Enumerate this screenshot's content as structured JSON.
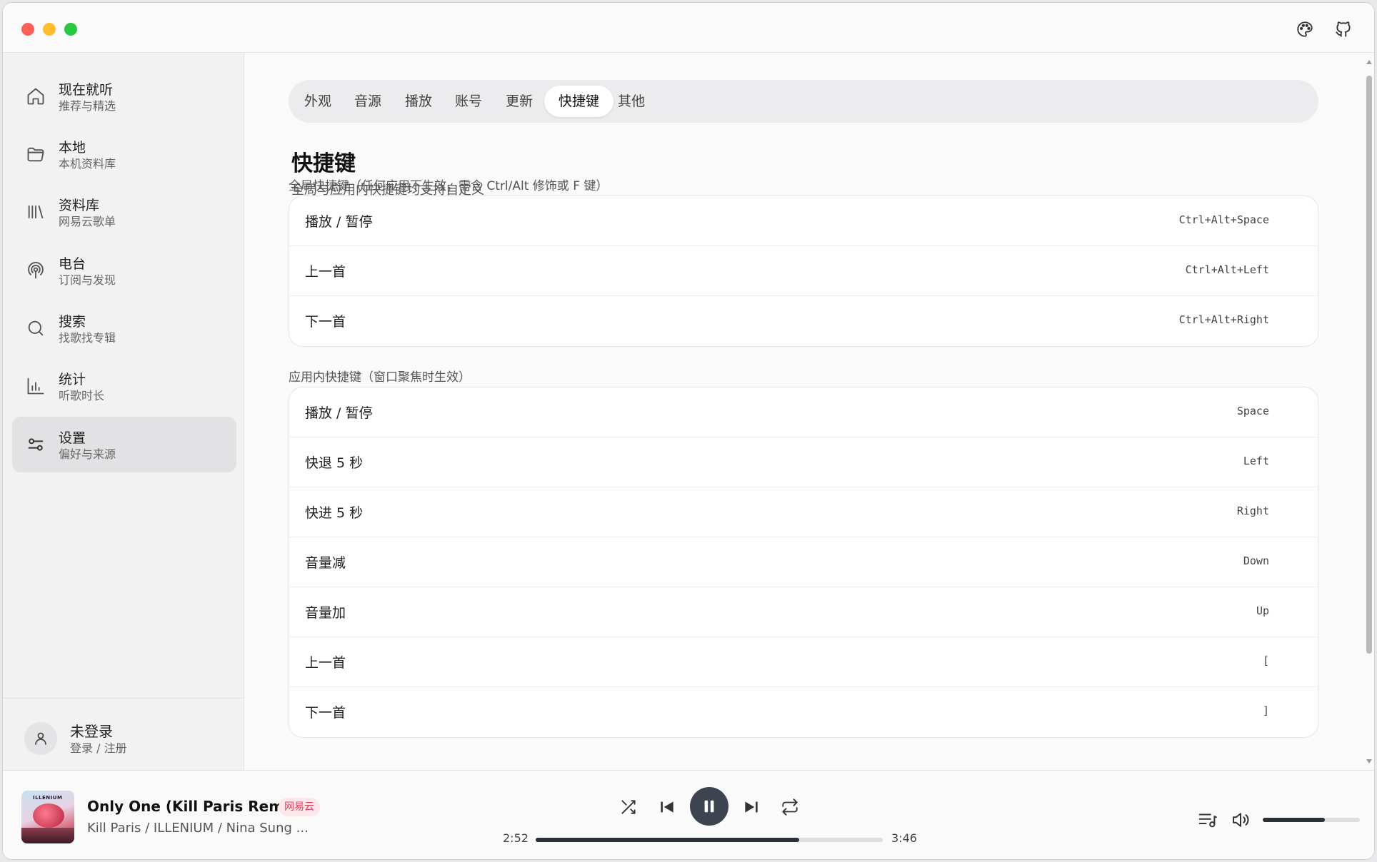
{
  "sidebar": {
    "items": [
      {
        "label": "现在就听",
        "sub": "推荐与精选",
        "icon": "home-icon"
      },
      {
        "label": "本地",
        "sub": "本机资料库",
        "icon": "folder-icon"
      },
      {
        "label": "资料库",
        "sub": "网易云歌单",
        "icon": "library-icon"
      },
      {
        "label": "电台",
        "sub": "订阅与发现",
        "icon": "radio-icon"
      },
      {
        "label": "搜索",
        "sub": "找歌找专辑",
        "icon": "search-icon"
      },
      {
        "label": "统计",
        "sub": "听歌时长",
        "icon": "stats-icon"
      },
      {
        "label": "设置",
        "sub": "偏好与来源",
        "icon": "settings-icon"
      }
    ],
    "active_index": 6,
    "user": {
      "name": "未登录",
      "sub": "登录 / 注册"
    }
  },
  "tabs": [
    "外观",
    "音源",
    "播放",
    "账号",
    "更新",
    "快捷键",
    "其他"
  ],
  "active_tab": "快捷键",
  "page": {
    "title": "快捷键",
    "subtitle": "全局与应用内快捷键均支持自定义"
  },
  "global_section": {
    "label": "全局快捷键（任何应用下生效，需含 Ctrl/Alt 修饰或 F 键）",
    "rows": [
      {
        "label": "播放 / 暂停",
        "key": "Ctrl+Alt+Space"
      },
      {
        "label": "上一首",
        "key": "Ctrl+Alt+Left"
      },
      {
        "label": "下一首",
        "key": "Ctrl+Alt+Right"
      }
    ]
  },
  "app_section": {
    "label": "应用内快捷键（窗口聚焦时生效）",
    "rows": [
      {
        "label": "播放 / 暂停",
        "key": "Space"
      },
      {
        "label": "快退 5 秒",
        "key": "Left"
      },
      {
        "label": "快进 5 秒",
        "key": "Right"
      },
      {
        "label": "音量减",
        "key": "Down"
      },
      {
        "label": "音量加",
        "key": "Up"
      },
      {
        "label": "上一首",
        "key": "["
      },
      {
        "label": "下一首",
        "key": "]"
      }
    ]
  },
  "player": {
    "title": "Only One (Kill Paris Remix)",
    "source": "网易云",
    "artist": "Kill Paris / ILLENIUM / Nina Sung ...",
    "cover_text": "ILLENIUM",
    "elapsed": "2:52",
    "duration": "3:46",
    "progress_fraction": 0.76,
    "volume_fraction": 0.64
  },
  "colors": {
    "accent_dark": "#2b2f36",
    "badge_text": "#e0405c",
    "badge_bg": "#fde7ea"
  }
}
